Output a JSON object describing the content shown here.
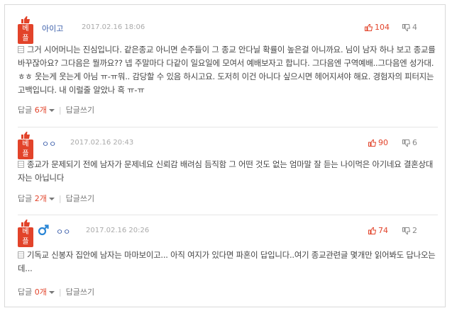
{
  "best_badge": "베플",
  "comments": [
    {
      "nickname": "아이고",
      "date": "2017.02.16 18:06",
      "likes": "104",
      "dislikes": "4",
      "text": "그거 시어머니는 진심입니다. 같은종교 아니면 손주들이 그 종교 안다닐 확률이 높은걸 아니까요. 님이 남자 하나 보고 종교를 바꾸잖아요? 그다음은 뭘까요?? 넵 주말마다 다같이 일요일에 모여서 예배보자고 합니다. 그다음엔 구역예배..그다음엔 성가대. ㅎㅎ 웃는게 웃는게 아님 ㅠ-ㅠ뭐.. 감당할 수 있음 하시고요. 도저히 이건 아니다 싶으시면 헤어지셔야 해요. 경험자의 피터지는 고백입니다. 내 이럴줄 알았나 흑 ㅠ-ㅠ",
      "reply_label": "답글",
      "reply_count": "6개",
      "write_reply": "답글쓰기"
    },
    {
      "nickname": "ㅇㅇ",
      "date": "2017.02.16 20:43",
      "likes": "90",
      "dislikes": "6",
      "text": "종교가 문제되기 전에 남자가 문제네요 신뢰감 배려심 듬직함 그 어떤 것도 없는 엄마말 잘 듣는 나이먹은 아기네요 결혼상대자는 아닙니다",
      "reply_label": "답글",
      "reply_count": "2개",
      "write_reply": "답글쓰기"
    },
    {
      "nickname": "ㅇㅇ",
      "date": "2017.02.16 20:26",
      "likes": "74",
      "dislikes": "2",
      "text": "기독교 신봉자 집안에 남자는 마마보이고... 아직 여지가 있다면 파혼이 답입니다..여기 종교관련글 몇개만 읽어봐도 답나오는데...",
      "reply_label": "답글",
      "reply_count": "0개",
      "write_reply": "답글쓰기"
    }
  ],
  "colors": {
    "accent": "#e2432a",
    "nick": "#3b5eaa",
    "male": "#2a86d6"
  },
  "icons": [
    "thumbs-up-icon",
    "thumbs-down-icon",
    "male-icon",
    "document-icon",
    "caret-down-icon"
  ]
}
